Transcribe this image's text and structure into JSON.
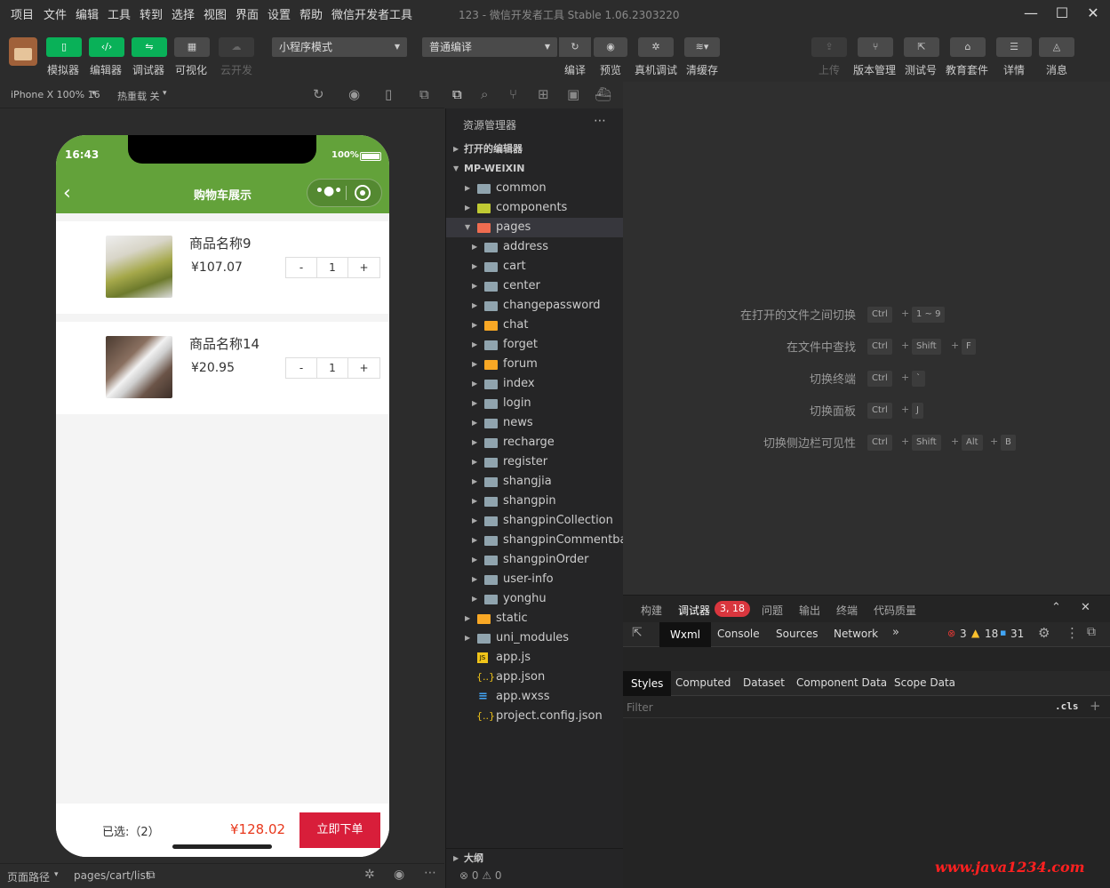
{
  "menu": [
    "项目",
    "文件",
    "编辑",
    "工具",
    "转到",
    "选择",
    "视图",
    "界面",
    "设置",
    "帮助",
    "微信开发者工具"
  ],
  "window_title": "123 - 微信开发者工具 Stable 1.06.2303220",
  "toolbar": {
    "simulator": "模拟器",
    "editor": "编辑器",
    "debugger": "调试器",
    "visual": "可视化",
    "cloud": "云开发",
    "mode_select": "小程序模式",
    "compile_select": "普通编译",
    "compile": "编译",
    "preview": "预览",
    "real_debug": "真机调试",
    "clear_cache": "清缓存",
    "upload": "上传",
    "version": "版本管理",
    "test_account": "测试号",
    "edu": "教育套件",
    "details": "详情",
    "messages": "消息"
  },
  "sim": {
    "device": "iPhone X 100% 16",
    "hot_reload": "热重载 关",
    "time": "16:43",
    "battery": "100%",
    "nav_title": "购物车展示",
    "items": [
      {
        "name": "商品名称9",
        "price": "¥107.07",
        "qty": "1"
      },
      {
        "name": "商品名称14",
        "price": "¥20.95",
        "qty": "1"
      }
    ],
    "minus": "-",
    "plus": "+",
    "selected": "已选:（2）",
    "total": "¥128.02",
    "order_button": "立即下单"
  },
  "statusbar": {
    "path_label": "页面路径",
    "path": "pages/cart/list"
  },
  "explorer": {
    "title": "资源管理器",
    "open_editors": "打开的编辑器",
    "root": "MP-WEIXIN",
    "top_folders": [
      "common",
      "components",
      "pages"
    ],
    "pages_children": [
      "address",
      "cart",
      "center",
      "changepassword",
      "chat",
      "forget",
      "forum",
      "index",
      "login",
      "news",
      "recharge",
      "register",
      "shangjia",
      "shangpin",
      "shangpinCollection",
      "shangpinCommentba...",
      "shangpinOrder",
      "user-info",
      "yonghu"
    ],
    "bottom_folders": [
      "static",
      "uni_modules"
    ],
    "files": [
      "app.js",
      "app.json",
      "app.wxss",
      "project.config.json"
    ],
    "outline": "大纲",
    "problems": "⊗ 0 ⚠ 0"
  },
  "shortcuts": [
    {
      "label": "在打开的文件之间切换",
      "keys": [
        "Ctrl",
        "1 ~ 9"
      ]
    },
    {
      "label": "在文件中查找",
      "keys": [
        "Ctrl",
        "Shift",
        "F"
      ]
    },
    {
      "label": "切换终端",
      "keys": [
        "Ctrl",
        "`"
      ]
    },
    {
      "label": "切换面板",
      "keys": [
        "Ctrl",
        "J"
      ]
    },
    {
      "label": "切换侧边栏可见性",
      "keys": [
        "Ctrl",
        "Shift",
        "Alt",
        "B"
      ]
    }
  ],
  "debugger": {
    "tabs": [
      "构建",
      "调试器",
      "问题",
      "输出",
      "终端",
      "代码质量"
    ],
    "badge": "3, 18",
    "devtabs": [
      "Wxml",
      "Console",
      "Sources",
      "Network"
    ],
    "errors": "3",
    "warnings": "18",
    "infos": "31",
    "style_tabs": [
      "Styles",
      "Computed",
      "Dataset",
      "Component Data",
      "Scope Data"
    ],
    "filter_placeholder": "Filter",
    "cls": ".cls"
  },
  "watermark": "www.java1234.com",
  "colors": {
    "green": "#63a23a",
    "accent_green": "#09b158",
    "price_red": "#e8381c",
    "order_red": "#d81e3a"
  }
}
